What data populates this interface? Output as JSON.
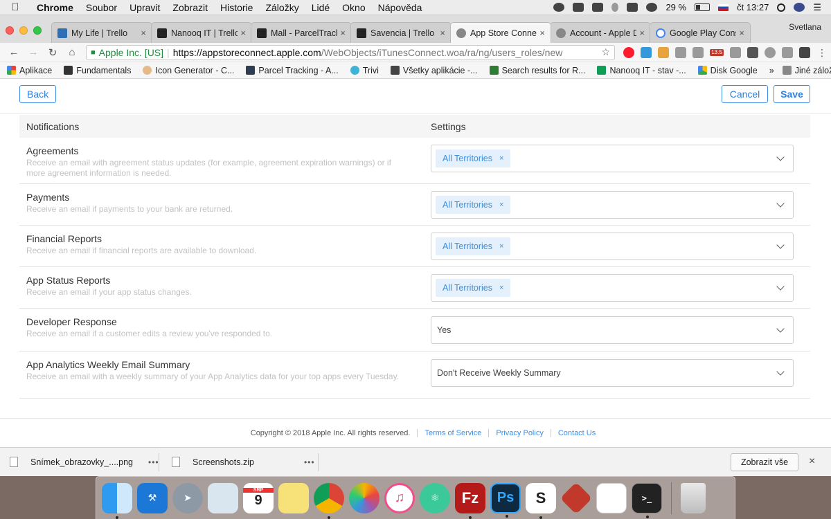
{
  "menubar": {
    "app_name": "Chrome",
    "items": [
      "Soubor",
      "Upravit",
      "Zobrazit",
      "Historie",
      "Záložky",
      "Lidé",
      "Okno",
      "Nápověda"
    ],
    "battery": "29 %",
    "clock": "čt 13:27"
  },
  "tabs": [
    {
      "title": "My Life | Trello"
    },
    {
      "title": "Nanooq IT | Trello"
    },
    {
      "title": "Mall - ParcelTrack"
    },
    {
      "title": "Savencia | Trello"
    },
    {
      "title": "App Store Connect"
    },
    {
      "title": "Account - Apple D"
    },
    {
      "title": "Google Play Cons"
    }
  ],
  "profile_name": "Svetlana",
  "omnibar": {
    "secure_label": "Apple Inc. [US]",
    "url_scheme_host": "https://appstoreconnect.apple.com",
    "url_path": "/WebObjects/iTunesConnect.woa/ra/ng/users_roles/new",
    "ext_badge": "13.5"
  },
  "bookmarks": {
    "items": [
      "Aplikace",
      "Fundamentals",
      "Icon Generator - C...",
      "Parcel Tracking - A...",
      "Trivi",
      "Všetky aplikácie -...",
      "Search results for R...",
      "Nanooq IT - stav -...",
      "Disk Google"
    ],
    "more_label": "Jiné záložky"
  },
  "page": {
    "back_label": "Back",
    "cancel_label": "Cancel",
    "save_label": "Save",
    "col_notifications": "Notifications",
    "col_settings": "Settings",
    "rows": [
      {
        "title": "Agreements",
        "desc": "Receive an email with agreement status updates (for example, agreement expiration warnings) or if more agreement information is needed.",
        "value": "All Territories"
      },
      {
        "title": "Payments",
        "desc": "Receive an email if payments to your bank are returned.",
        "value": "All Territories"
      },
      {
        "title": "Financial Reports",
        "desc": "Receive an email if financial reports are available to download.",
        "value": "All Territories"
      },
      {
        "title": "App Status Reports",
        "desc": "Receive an email if your app status changes.",
        "value": "All Territories"
      },
      {
        "title": "Developer Response",
        "desc": "Receive an email if a customer edits a review you've responded to.",
        "value": "Yes"
      },
      {
        "title": "App Analytics Weekly Email Summary",
        "desc": "Receive an email with a weekly summary of your App Analytics data for your top apps every Tuesday.",
        "value": "Don't Receive Weekly Summary"
      }
    ],
    "footer": {
      "copyright": "Copyright © 2018 Apple Inc. All rights reserved.",
      "terms": "Terms of Service",
      "privacy": "Privacy Policy",
      "contact": "Contact Us"
    }
  },
  "downloads": {
    "files": [
      "Snímek_obrazovky_....png",
      "Screenshots.zip"
    ],
    "show_all_label": "Zobrazit vše"
  },
  "dock": {
    "calendar_month": "SRP",
    "calendar_day": "9"
  },
  "colors": {
    "accent": "#3d8ee9",
    "pill_bg": "#e4f0fb",
    "secure_green": "#1e8e3e"
  }
}
